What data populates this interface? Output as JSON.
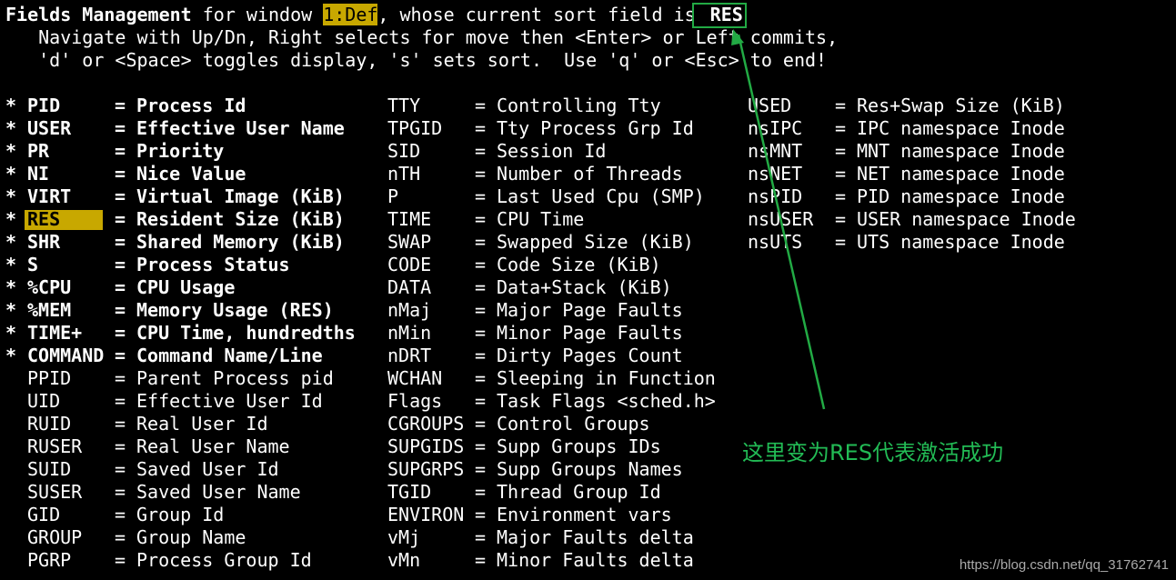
{
  "header": {
    "title_bold": "Fields Management",
    "title_mid": " for window ",
    "window_name": "1:Def",
    "title_tail": ", whose current sort field is ",
    "sort_field": "RES",
    "help_line1": "   Navigate with Up/Dn, Right selects for move then <Enter> or Left commits,",
    "help_line2": "   'd' or <Space> toggles display, 's' sets sort.  Use 'q' or <Esc> to end!"
  },
  "col1": [
    {
      "star": "*",
      "abbr": "PID",
      "eq": "=",
      "desc": "Process Id",
      "active": true
    },
    {
      "star": "*",
      "abbr": "USER",
      "eq": "=",
      "desc": "Effective User Name",
      "active": true
    },
    {
      "star": "*",
      "abbr": "PR",
      "eq": "=",
      "desc": "Priority",
      "active": true
    },
    {
      "star": "*",
      "abbr": "NI",
      "eq": "=",
      "desc": "Nice Value",
      "active": true
    },
    {
      "star": "*",
      "abbr": "VIRT",
      "eq": "=",
      "desc": "Virtual Image (KiB)",
      "active": true
    },
    {
      "star": "*",
      "abbr": "RES",
      "eq": "=",
      "desc": "Resident Size (KiB)",
      "active": true,
      "selected": true
    },
    {
      "star": "*",
      "abbr": "SHR",
      "eq": "=",
      "desc": "Shared Memory (KiB)",
      "active": true
    },
    {
      "star": "*",
      "abbr": "S",
      "eq": "=",
      "desc": "Process Status",
      "active": true
    },
    {
      "star": "*",
      "abbr": "%CPU",
      "eq": "=",
      "desc": "CPU Usage",
      "active": true
    },
    {
      "star": "*",
      "abbr": "%MEM",
      "eq": "=",
      "desc": "Memory Usage (RES)",
      "active": true
    },
    {
      "star": "*",
      "abbr": "TIME+",
      "eq": "=",
      "desc": "CPU Time, hundredths",
      "active": true
    },
    {
      "star": "*",
      "abbr": "COMMAND",
      "eq": "=",
      "desc": "Command Name/Line",
      "active": true
    },
    {
      "star": "",
      "abbr": "PPID",
      "eq": "=",
      "desc": "Parent Process pid",
      "active": false
    },
    {
      "star": "",
      "abbr": "UID",
      "eq": "=",
      "desc": "Effective User Id",
      "active": false
    },
    {
      "star": "",
      "abbr": "RUID",
      "eq": "=",
      "desc": "Real User Id",
      "active": false
    },
    {
      "star": "",
      "abbr": "RUSER",
      "eq": "=",
      "desc": "Real User Name",
      "active": false
    },
    {
      "star": "",
      "abbr": "SUID",
      "eq": "=",
      "desc": "Saved User Id",
      "active": false
    },
    {
      "star": "",
      "abbr": "SUSER",
      "eq": "=",
      "desc": "Saved User Name",
      "active": false
    },
    {
      "star": "",
      "abbr": "GID",
      "eq": "=",
      "desc": "Group Id",
      "active": false
    },
    {
      "star": "",
      "abbr": "GROUP",
      "eq": "=",
      "desc": "Group Name",
      "active": false
    },
    {
      "star": "",
      "abbr": "PGRP",
      "eq": "=",
      "desc": "Process Group Id",
      "active": false
    }
  ],
  "col2": [
    {
      "abbr": "TTY",
      "eq": "=",
      "desc": "Controlling Tty"
    },
    {
      "abbr": "TPGID",
      "eq": "=",
      "desc": "Tty Process Grp Id"
    },
    {
      "abbr": "SID",
      "eq": "=",
      "desc": "Session Id"
    },
    {
      "abbr": "nTH",
      "eq": "=",
      "desc": "Number of Threads"
    },
    {
      "abbr": "P",
      "eq": "=",
      "desc": "Last Used Cpu (SMP)"
    },
    {
      "abbr": "TIME",
      "eq": "=",
      "desc": "CPU Time"
    },
    {
      "abbr": "SWAP",
      "eq": "=",
      "desc": "Swapped Size (KiB)"
    },
    {
      "abbr": "CODE",
      "eq": "=",
      "desc": "Code Size (KiB)"
    },
    {
      "abbr": "DATA",
      "eq": "=",
      "desc": "Data+Stack (KiB)"
    },
    {
      "abbr": "nMaj",
      "eq": "=",
      "desc": "Major Page Faults"
    },
    {
      "abbr": "nMin",
      "eq": "=",
      "desc": "Minor Page Faults"
    },
    {
      "abbr": "nDRT",
      "eq": "=",
      "desc": "Dirty Pages Count"
    },
    {
      "abbr": "WCHAN",
      "eq": "=",
      "desc": "Sleeping in Function"
    },
    {
      "abbr": "Flags",
      "eq": "=",
      "desc": "Task Flags <sched.h>"
    },
    {
      "abbr": "CGROUPS",
      "eq": "=",
      "desc": "Control Groups"
    },
    {
      "abbr": "SUPGIDS",
      "eq": "=",
      "desc": "Supp Groups IDs"
    },
    {
      "abbr": "SUPGRPS",
      "eq": "=",
      "desc": "Supp Groups Names"
    },
    {
      "abbr": "TGID",
      "eq": "=",
      "desc": "Thread Group Id"
    },
    {
      "abbr": "ENVIRON",
      "eq": "=",
      "desc": "Environment vars"
    },
    {
      "abbr": "vMj",
      "eq": "=",
      "desc": "Major Faults delta"
    },
    {
      "abbr": "vMn",
      "eq": "=",
      "desc": "Minor Faults delta"
    }
  ],
  "col3": [
    {
      "abbr": "USED",
      "eq": "=",
      "desc": "Res+Swap Size (KiB)"
    },
    {
      "abbr": "nsIPC",
      "eq": "=",
      "desc": "IPC namespace Inode"
    },
    {
      "abbr": "nsMNT",
      "eq": "=",
      "desc": "MNT namespace Inode"
    },
    {
      "abbr": "nsNET",
      "eq": "=",
      "desc": "NET namespace Inode"
    },
    {
      "abbr": "nsPID",
      "eq": "=",
      "desc": "PID namespace Inode"
    },
    {
      "abbr": "nsUSER",
      "eq": "=",
      "desc": "USER namespace Inode"
    },
    {
      "abbr": "nsUTS",
      "eq": "=",
      "desc": "UTS namespace Inode"
    }
  ],
  "annotation": "这里变为RES代表激活成功",
  "watermark": "https://blog.csdn.net/qq_31762741",
  "colors": {
    "highlight": "#c8a800",
    "annotation": "#22bb55",
    "background": "#000000",
    "text": "#ffffff"
  }
}
